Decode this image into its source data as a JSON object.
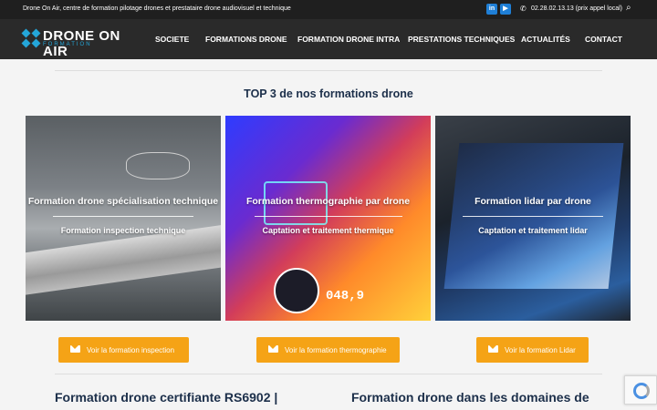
{
  "topbar": {
    "tagline": "Drone On Air, centre de formation pilotage drones et prestataire drone audiovisuel et technique",
    "linkedin_icon": "linkedin-icon",
    "youtube_icon": "youtube-icon",
    "phone_icon": "phone-icon",
    "phone": "02.28.02.13.13 (prix appel local)",
    "search_icon": "search-icon"
  },
  "header": {
    "logo_text": "DRONE ON AIR",
    "logo_sub": "FORMATION",
    "nav": [
      "SOCIETE",
      "FORMATIONS DRONE",
      "FORMATION DRONE INTRA",
      "PRESTATIONS TECHNIQUES",
      "ACTUALITÉS",
      "CONTACT"
    ]
  },
  "main": {
    "section_title": "TOP 3 de nos formations drone",
    "cards": [
      {
        "title": "Formation drone spécialisation technique",
        "subtitle": "Formation inspection technique"
      },
      {
        "title": "Formation thermographie par drone",
        "subtitle": "Captation et traitement thermique",
        "readout": "048,9"
      },
      {
        "title": "Formation lidar par drone",
        "subtitle": "Captation et traitement lidar"
      }
    ],
    "buttons": [
      "Voir la formation inspection",
      "Voir la formation thermographie",
      "Voir la formation Lidar"
    ],
    "bottom_titles": [
      "Formation drone certifiante RS6902 |",
      "Formation drone dans les domaines de"
    ]
  },
  "colors": {
    "accent": "#f5a316",
    "brand_blue": "#24a6d9",
    "header_bg": "#2a2a2a",
    "title_navy": "#1c2f4a"
  }
}
